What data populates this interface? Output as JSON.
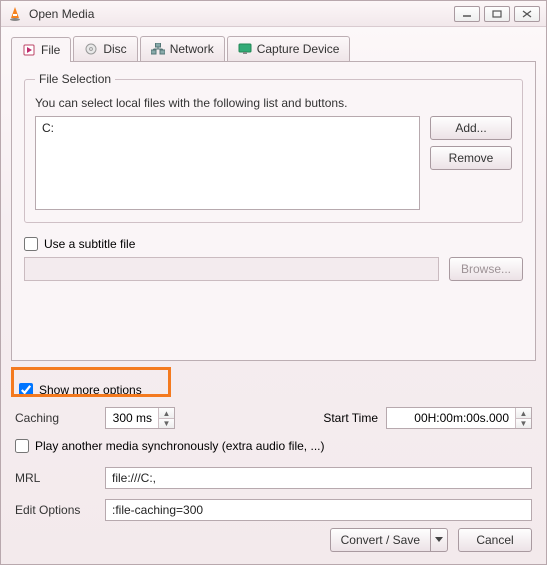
{
  "window": {
    "title": "Open Media"
  },
  "tabs": {
    "file": "File",
    "disc": "Disc",
    "network": "Network",
    "capture": "Capture Device"
  },
  "fileselection": {
    "legend": "File Selection",
    "hint": "You can select local files with the following list and buttons.",
    "list_value": "C:",
    "add": "Add...",
    "remove": "Remove"
  },
  "subtitle": {
    "use_label": "Use a subtitle file",
    "browse": "Browse..."
  },
  "more_options": {
    "prefix": "Show ",
    "underlined": "m",
    "suffix": "ore options"
  },
  "options": {
    "caching_label": "Caching",
    "caching_value": "300 ms",
    "start_label": "Start Time",
    "start_value": "00H:00m:00s.000",
    "play_sync_label": "Play another media synchronously (extra audio file, ...)",
    "mrl_label": "MRL",
    "mrl_value": "file:///C:,",
    "edit_label": "Edit Options",
    "edit_value": ":file-caching=300"
  },
  "footer": {
    "convert": "Convert / Save",
    "cancel": "Cancel"
  }
}
